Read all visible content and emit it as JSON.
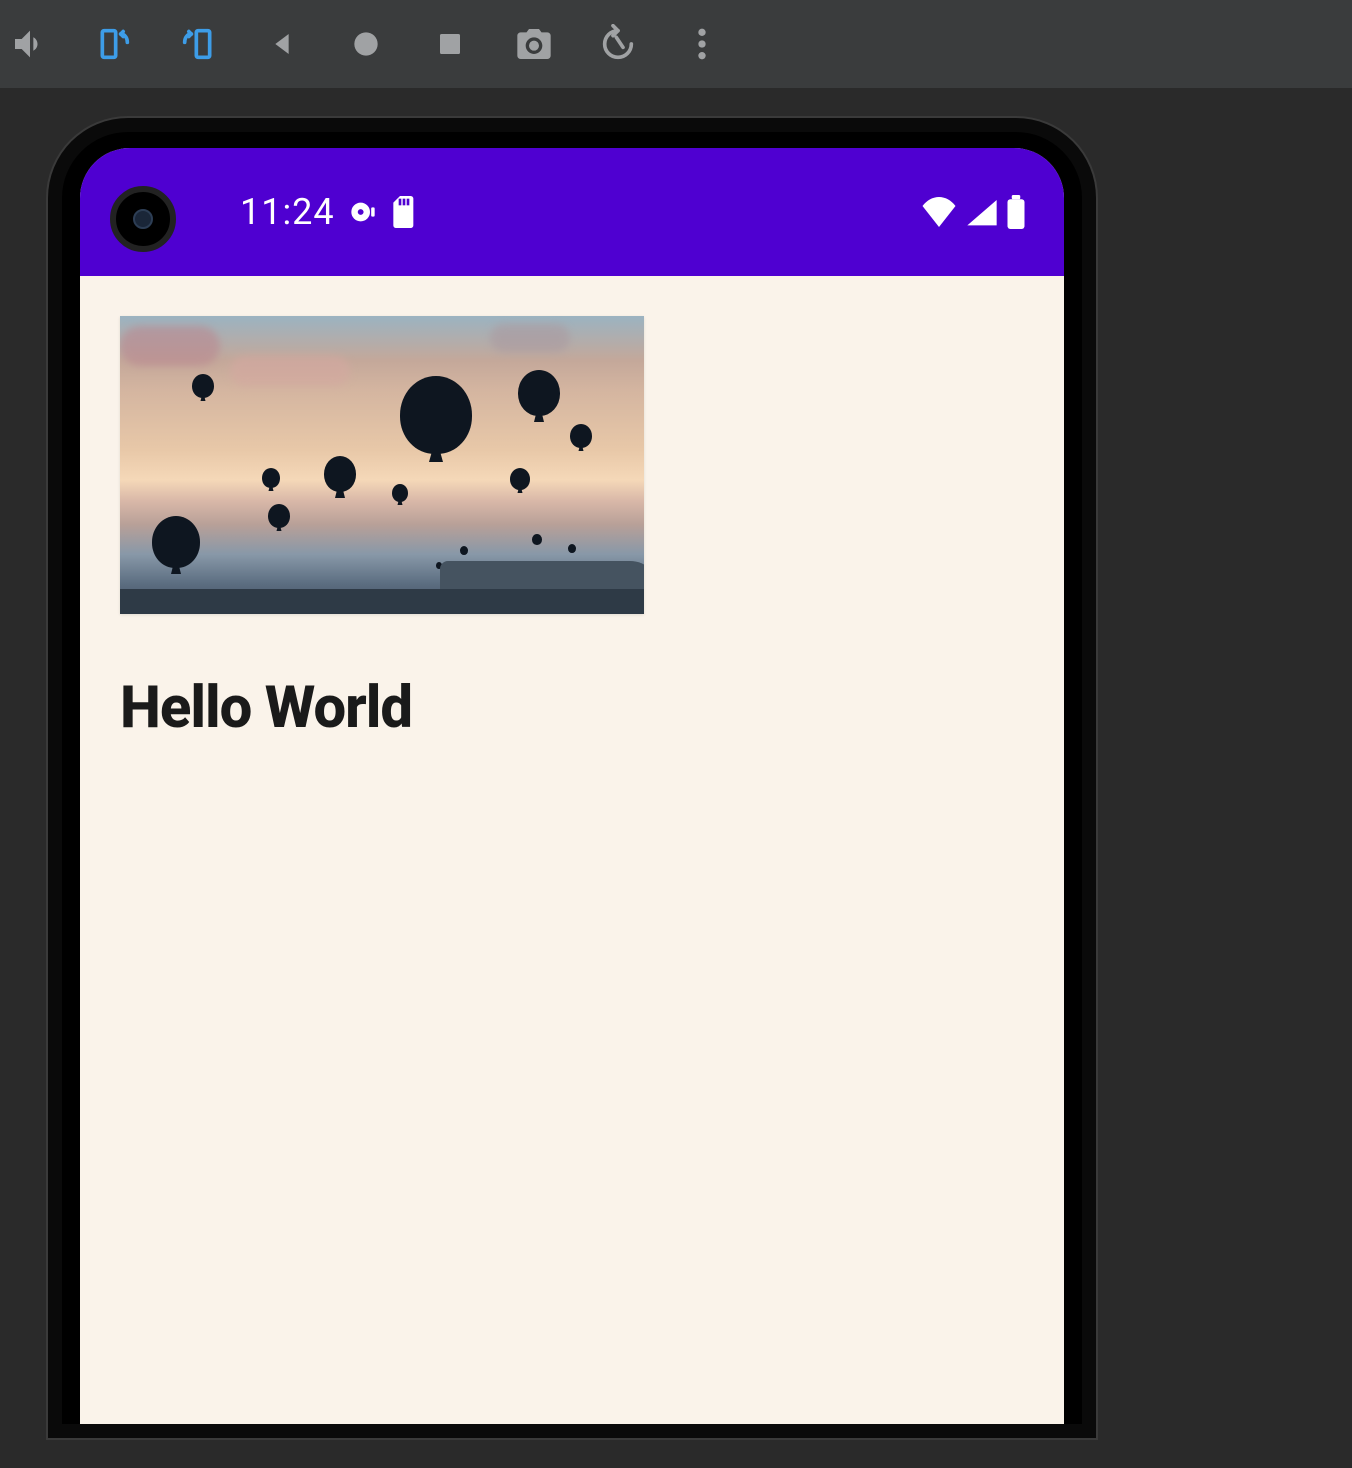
{
  "emulator_toolbar": {
    "icons": {
      "volume": "volume-icon",
      "rotate_left": "rotate-left-icon",
      "rotate_right": "rotate-right-icon",
      "back": "back-icon",
      "record": "record-icon",
      "stop": "stop-icon",
      "camera": "camera-icon",
      "restart": "restart-icon",
      "more": "more-icon"
    }
  },
  "status_bar": {
    "time": "11:24",
    "icons": {
      "disc": "disc-icon",
      "sd": "sd-card-icon",
      "wifi": "wifi-icon",
      "signal": "signal-icon",
      "battery": "battery-icon"
    },
    "background_color": "#4f00d1"
  },
  "app": {
    "image_alt": "Hot air balloons at sunset",
    "heading": "Hello World",
    "background_color": "#faf3ea"
  }
}
